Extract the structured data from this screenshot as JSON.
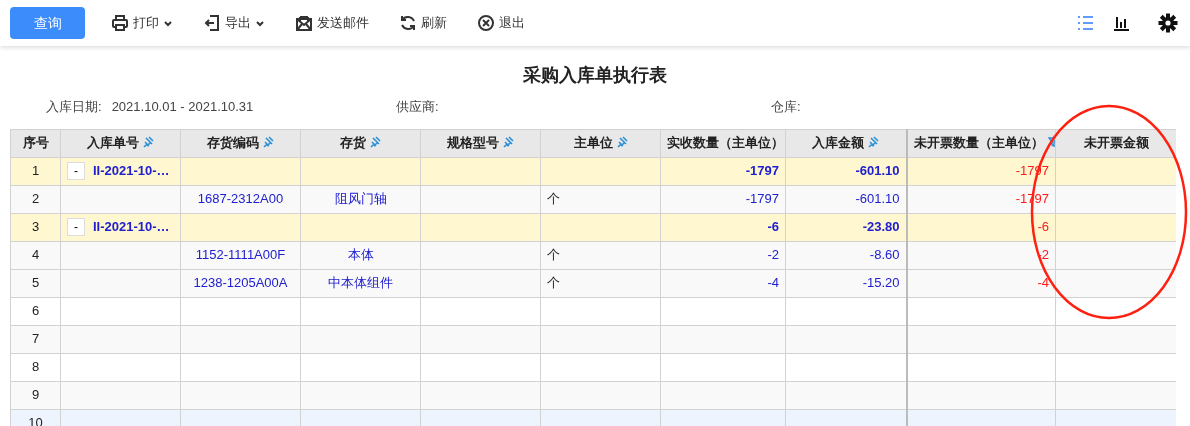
{
  "toolbar": {
    "buttons": [
      {
        "kind": "primary",
        "label": "查询"
      },
      {
        "kind": "print",
        "label": "打印",
        "dropdown": true
      },
      {
        "kind": "export",
        "label": "导出",
        "dropdown": true
      },
      {
        "kind": "mail",
        "label": "发送邮件",
        "dropdown": false
      },
      {
        "kind": "refresh",
        "label": "刷新",
        "dropdown": false
      },
      {
        "kind": "exit",
        "label": "退出",
        "dropdown": false
      }
    ],
    "views": [
      {
        "kind": "list",
        "selected": true
      },
      {
        "kind": "chart",
        "selected": false
      }
    ]
  },
  "title": "采购入库单执行表",
  "filters": [
    {
      "label": "入库日期:",
      "value": "2021.10.01 - 2021.10.31"
    },
    {
      "label": "供应商:"
    },
    {
      "label": "仓库:"
    }
  ],
  "table": {
    "columns": [
      {
        "label": "序号",
        "kind": "plain"
      },
      {
        "label": "入库单号",
        "kind": "pinned"
      },
      {
        "label": "存货编码",
        "kind": "pinned"
      },
      {
        "label": "存货",
        "kind": "pinned"
      },
      {
        "label": "规格型号",
        "kind": "pinned"
      },
      {
        "label": "主单位",
        "kind": "pinned"
      },
      {
        "label": "实收数量（主单位）",
        "kind": "plain"
      },
      {
        "label": "入库金额",
        "kind": "pinned"
      },
      {
        "label": "未开票数量（主单位）",
        "kind": "filtered"
      },
      {
        "label": "未开票金额",
        "kind": "plain"
      }
    ],
    "rows": [
      {
        "kind": "group",
        "selected": false,
        "cells": [
          "1",
          "II-2021-10-…",
          "",
          "",
          "",
          "",
          "-1797",
          "-601.10",
          "-1797",
          ""
        ],
        "toggle": "-"
      },
      {
        "kind": "item",
        "selected": false,
        "cells": [
          "2",
          "",
          "1687-2312A00",
          "阻风门轴",
          "",
          "个",
          "-1797",
          "-601.10",
          "-1797",
          ""
        ]
      },
      {
        "kind": "group",
        "selected": false,
        "cells": [
          "3",
          "II-2021-10-…",
          "",
          "",
          "",
          "",
          "-6",
          "-23.80",
          "-6",
          ""
        ],
        "toggle": "-"
      },
      {
        "kind": "item",
        "selected": false,
        "cells": [
          "4",
          "",
          "1152-1111A00F",
          "本体",
          "",
          "个",
          "-2",
          "-8.60",
          "-2",
          ""
        ]
      },
      {
        "kind": "item",
        "selected": false,
        "cells": [
          "5",
          "",
          "1238-1205A00A",
          "中本体组件",
          "",
          "个",
          "-4",
          "-15.20",
          "-4",
          ""
        ]
      },
      {
        "kind": "empty",
        "selected": false,
        "cells": [
          "6",
          "",
          "",
          "",
          "",
          "",
          "",
          "",
          "",
          ""
        ]
      },
      {
        "kind": "empty",
        "selected": false,
        "cells": [
          "7",
          "",
          "",
          "",
          "",
          "",
          "",
          "",
          "",
          ""
        ]
      },
      {
        "kind": "empty",
        "selected": false,
        "cells": [
          "8",
          "",
          "",
          "",
          "",
          "",
          "",
          "",
          "",
          ""
        ]
      },
      {
        "kind": "empty",
        "selected": false,
        "cells": [
          "9",
          "",
          "",
          "",
          "",
          "",
          "",
          "",
          "",
          ""
        ]
      },
      {
        "kind": "empty",
        "selected": true,
        "cells": [
          "10",
          "",
          "",
          "",
          "",
          "",
          "",
          "",
          "",
          ""
        ]
      }
    ]
  },
  "annotation": {
    "kind": "ellipse",
    "color": "#ff2010"
  }
}
